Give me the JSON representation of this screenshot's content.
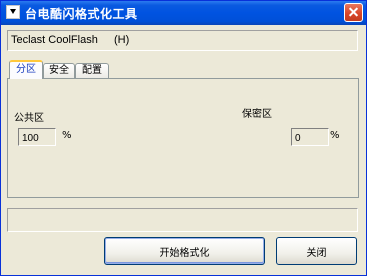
{
  "window": {
    "title": "台电酷闪格式化工具"
  },
  "device": {
    "name": "Teclast CoolFlash",
    "drive": "(H)"
  },
  "tabs": [
    {
      "label": "分区",
      "active": true
    },
    {
      "label": "安全",
      "active": false
    },
    {
      "label": "配置",
      "active": false
    }
  ],
  "partition": {
    "public_label": "公共区",
    "public_value": "100",
    "public_unit": "%",
    "private_label": "保密区",
    "private_value": "0",
    "private_unit": "%"
  },
  "status": {
    "text": ""
  },
  "buttons": {
    "start_format": "开始格式化",
    "close": "关闭"
  },
  "colors": {
    "titlebar": "#0053e1",
    "window_bg": "#ece9d8",
    "active_tab_text": "#1a3dbd",
    "close_button": "#d9462a"
  }
}
